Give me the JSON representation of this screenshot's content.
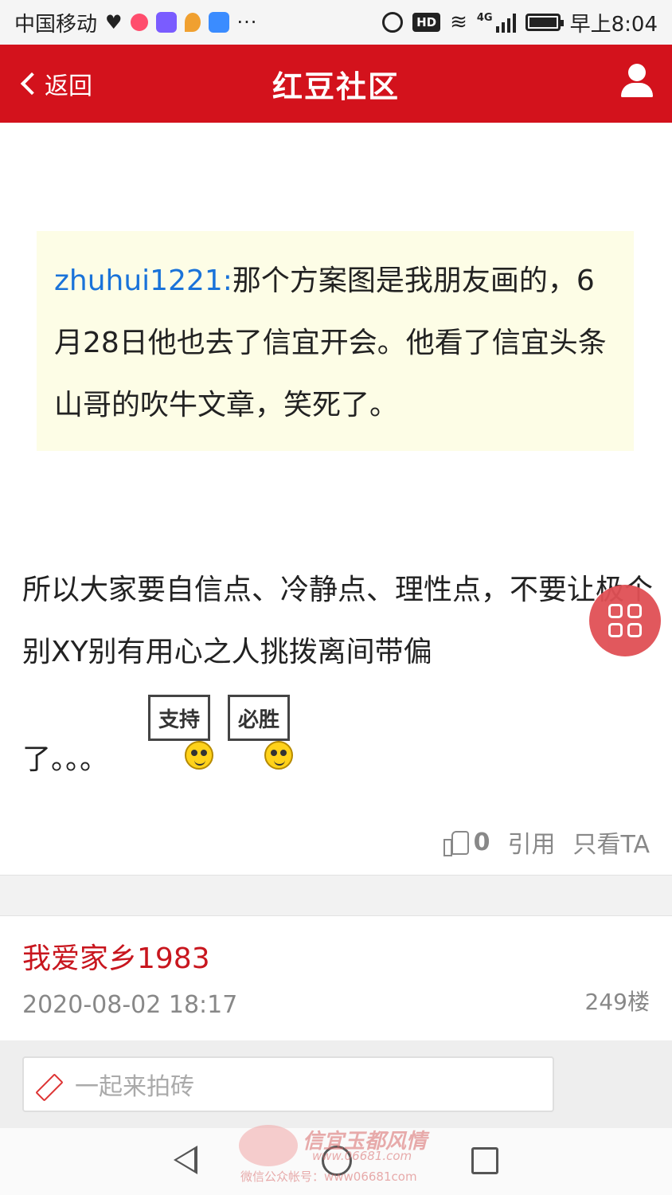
{
  "status_bar": {
    "carrier": "中国移动",
    "extra_indicator": "···",
    "network_label": "4G",
    "time": "早上8:04",
    "icons": [
      "health-heart-icon",
      "app-icon",
      "video-app-icon",
      "map-pin-icon",
      "tieba-icon",
      "alarm-icon",
      "hd-icon",
      "wifi-icon",
      "signal-icon",
      "battery-icon"
    ]
  },
  "header": {
    "back_label": "返回",
    "title": "红豆社区",
    "background": "#d3121c"
  },
  "quote": {
    "username": "zhuhui1221:",
    "text": "那个方案图是我朋友画的，6月28日他也去了信宜开会。他看了信宜头条山哥的吹牛文章，笑死了。"
  },
  "post": {
    "text": "所以大家要自信点、冷静点、理性点，不要让极个别XY别有用心之人挑拨离间带偏",
    "tail": "了。。。",
    "emoticons": [
      {
        "sign": "支持"
      },
      {
        "sign": "必胜"
      }
    ]
  },
  "actions": {
    "like_count": "0",
    "quote_label": "引用",
    "only_ta_label": "只看TA"
  },
  "next_post": {
    "author": "我爱家乡1983",
    "time": "2020-08-02 18:17",
    "floor": "249楼"
  },
  "comment": {
    "placeholder": "一起来拍砖"
  },
  "watermark": {
    "title": "信宜玉都风情",
    "url": "www.06681.com",
    "subtitle": "微信公众帐号：www06681com"
  }
}
